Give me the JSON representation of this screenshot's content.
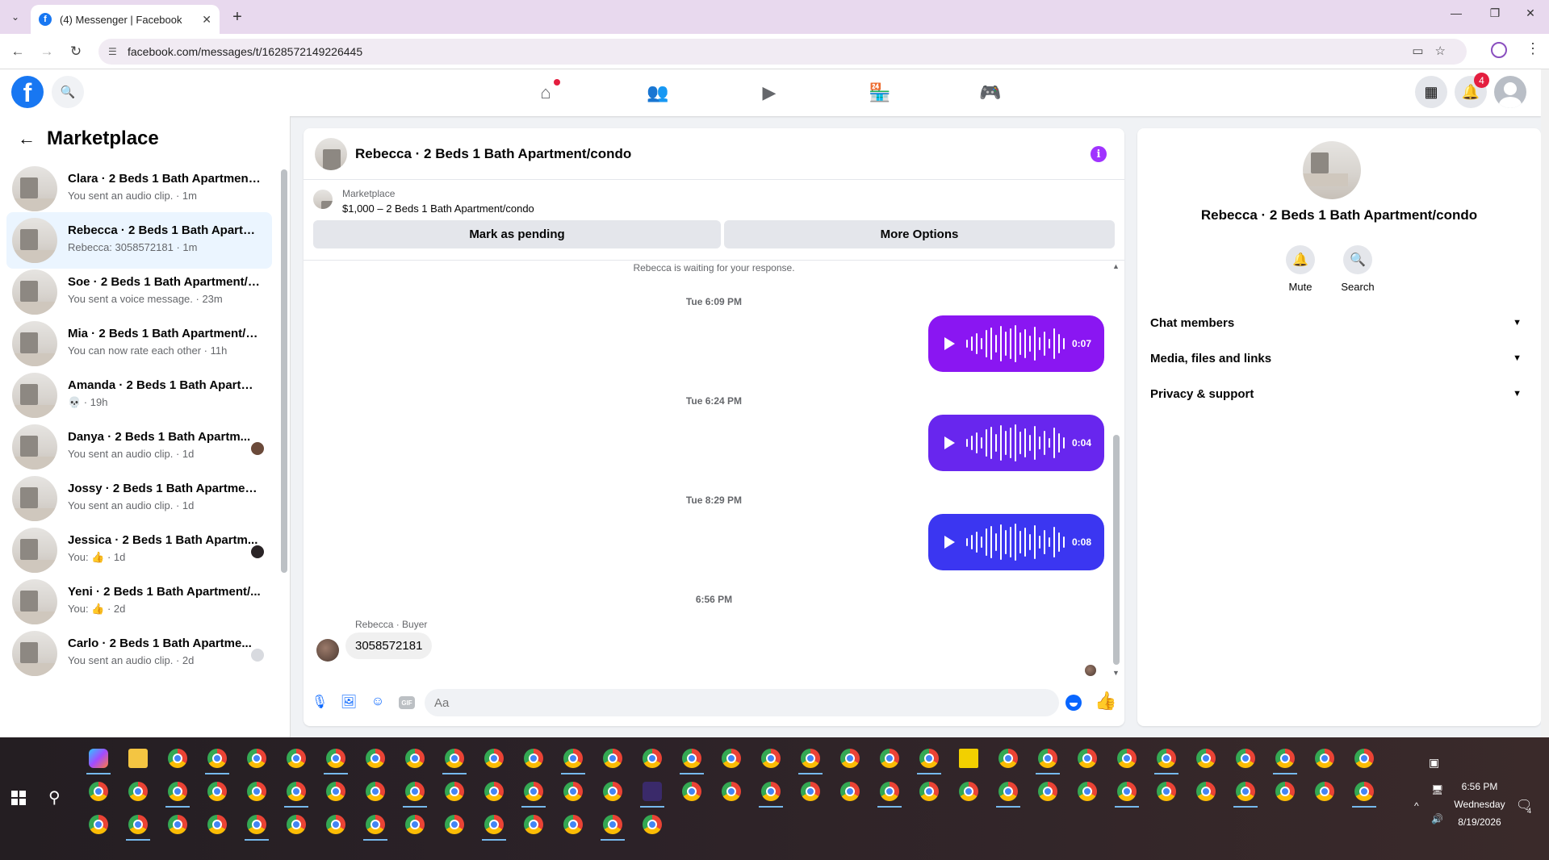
{
  "browser": {
    "tab_title": "(4) Messenger | Facebook",
    "url": "facebook.com/messages/t/1628572149226445"
  },
  "header": {
    "notification_count": "4"
  },
  "sidebar": {
    "title": "Marketplace",
    "conversations": [
      {
        "name": "Clara · 2 Beds 1 Bath Apartment/...",
        "preview": "You sent an audio clip. · 1m"
      },
      {
        "name": "Rebecca · 2 Beds 1 Bath Apartm...",
        "preview": "Rebecca: 3058572181 · 1m"
      },
      {
        "name": "Soe · 2 Beds 1 Bath Apartment/c...",
        "preview": "You sent a voice message. · 23m"
      },
      {
        "name": "Mia · 2 Beds 1 Bath Apartment/c...",
        "preview": "You can now rate each other · 11h"
      },
      {
        "name": "Amanda · 2 Beds 1 Bath Apartm...",
        "preview": "💀 · 19h"
      },
      {
        "name": "Danya · 2 Beds 1 Bath Apartm...",
        "preview": "You sent an audio clip. · 1d"
      },
      {
        "name": "Jossy · 2 Beds 1 Bath Apartment...",
        "preview": "You sent an audio clip. · 1d"
      },
      {
        "name": "Jessica · 2 Beds 1 Bath Apartm...",
        "preview": "You: 👍 · 1d"
      },
      {
        "name": "Yeni · 2 Beds 1 Bath Apartment/...",
        "preview": "You: 👍 · 2d"
      },
      {
        "name": "Carlo · 2 Beds 1 Bath Apartme...",
        "preview": "You sent an audio clip. · 2d"
      }
    ]
  },
  "chat": {
    "title": "Rebecca · 2 Beds 1 Bath Apartment/condo",
    "marketplace_label": "Marketplace",
    "listing": "$1,000 – 2 Beds 1 Bath Apartment/condo",
    "mark_pending": "Mark as pending",
    "more_options": "More Options",
    "waiting": "Rebecca is waiting for your response.",
    "messages": [
      {
        "time": "Tue 6:09 PM",
        "duration": "0:07",
        "color": "#8a16f2"
      },
      {
        "time": "Tue 6:24 PM",
        "duration": "0:04",
        "color": "#6826ee"
      },
      {
        "time": "Tue 8:29 PM",
        "duration": "0:08",
        "color": "#3b36f1"
      }
    ],
    "last_time": "6:56 PM",
    "sender_label": "Rebecca · Buyer",
    "incoming_text": "3058572181",
    "input_placeholder": "Aa"
  },
  "info_panel": {
    "title": "Rebecca · 2 Beds 1 Bath Apartment/condo",
    "mute": "Mute",
    "search": "Search",
    "sections": [
      "Chat members",
      "Media, files and links",
      "Privacy & support"
    ]
  },
  "taskbar": {
    "time": "6:56 PM",
    "day": "Wednesday",
    "date": "8/19/2026",
    "notif_count": "4"
  },
  "colors": {
    "fb_blue": "#1877f2",
    "messenger_blue": "#0866ff",
    "active_row": "#ebf5ff"
  }
}
